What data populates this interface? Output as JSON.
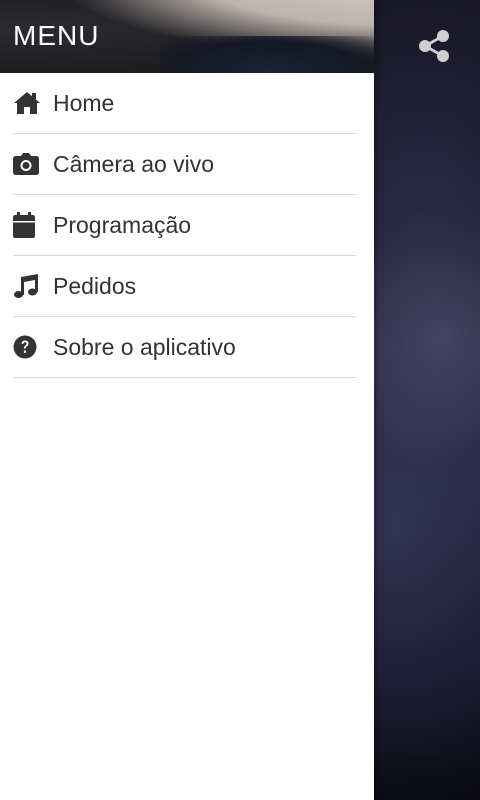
{
  "drawer": {
    "title": "MENU",
    "items": [
      {
        "label": "Home",
        "icon": "home-icon"
      },
      {
        "label": "Câmera ao vivo",
        "icon": "camera-icon"
      },
      {
        "label": "Programação",
        "icon": "calendar-icon"
      },
      {
        "label": "Pedidos",
        "icon": "music-note-icon"
      },
      {
        "label": "Sobre o aplicativo",
        "icon": "question-circle-icon"
      }
    ]
  },
  "toolbar": {
    "share_icon": "share-icon"
  },
  "colors": {
    "drawer_bg": "#ffffff",
    "item_text": "#333333",
    "divider": "#d8d8d8",
    "title_text": "#ffffff"
  }
}
